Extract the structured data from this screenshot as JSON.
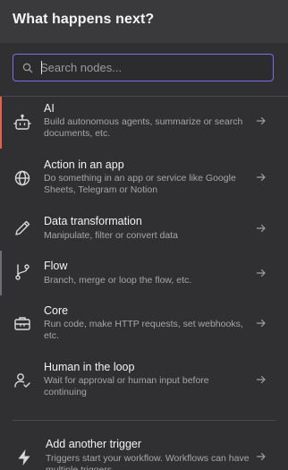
{
  "panel": {
    "title": "What happens next?"
  },
  "search": {
    "placeholder": "Search nodes...",
    "value": ""
  },
  "categories": [
    {
      "title": "AI",
      "description": "Build autonomous agents, summarize or search documents, etc.",
      "icon": "robot-icon",
      "accent": "#e8604c"
    },
    {
      "title": "Action in an app",
      "description": "Do something in an app or service like Google Sheets, Telegram or Notion",
      "icon": "globe-icon",
      "accent": ""
    },
    {
      "title": "Data transformation",
      "description": "Manipulate, filter or convert data",
      "icon": "pen-icon",
      "accent": ""
    },
    {
      "title": "Flow",
      "description": "Branch, merge or loop the flow, etc.",
      "icon": "branch-icon",
      "accent": "#6e6e72"
    },
    {
      "title": "Core",
      "description": "Run code, make HTTP requests, set webhooks, etc.",
      "icon": "toolbox-icon",
      "accent": ""
    },
    {
      "title": "Human in the loop",
      "description": "Wait for approval or human input before continuing",
      "icon": "person-check-icon",
      "accent": ""
    }
  ],
  "trigger": {
    "title": "Add another trigger",
    "description": "Triggers start your workflow. Workflows can have multiple triggers.",
    "icon": "bolt-icon"
  },
  "colors": {
    "background": "#303032",
    "header": "#3a3a3c",
    "search_border": "#7b6cf0",
    "text_primary": "#f2f2f4",
    "text_secondary": "#a6a6aa"
  }
}
